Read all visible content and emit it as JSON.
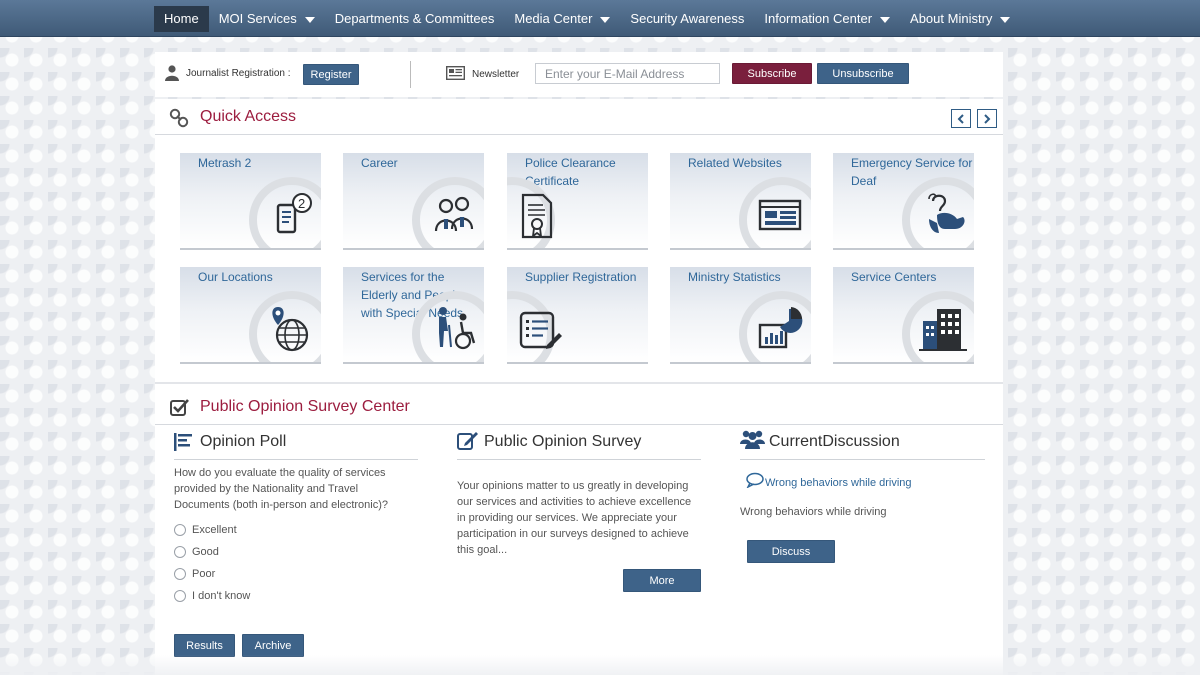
{
  "nav": {
    "items": [
      {
        "label": "Home",
        "active": true,
        "dropdown": false
      },
      {
        "label": "MOI Services",
        "dropdown": true
      },
      {
        "label": "Departments & Committees",
        "dropdown": false
      },
      {
        "label": "Media Center",
        "dropdown": true
      },
      {
        "label": "Security Awareness",
        "dropdown": false
      },
      {
        "label": "Information Center",
        "dropdown": true
      },
      {
        "label": "About Ministry",
        "dropdown": true
      }
    ]
  },
  "registration": {
    "label": "Journalist Registration :",
    "register_button": "Register"
  },
  "newsletter": {
    "label": "Newsletter",
    "email_placeholder": "Enter your E-Mail Address",
    "subscribe_button": "Subscribe",
    "unsubscribe_button": "Unsubscribe"
  },
  "quick_access": {
    "title": "Quick Access",
    "tiles": [
      {
        "label": "Metrash 2",
        "icon": "phone-metrash-icon"
      },
      {
        "label": "Career",
        "icon": "people-career-icon"
      },
      {
        "label": "Police Clearance Certificate",
        "icon": "certificate-icon"
      },
      {
        "label": "Related Websites",
        "icon": "websites-icon"
      },
      {
        "label": "Emergency Service for Deaf",
        "icon": "sign-language-icon"
      },
      {
        "label": "Our Locations",
        "icon": "globe-location-icon"
      },
      {
        "label": "Services for the Elderly and People with Special Needs",
        "icon": "elderly-wheelchair-icon"
      },
      {
        "label": "Supplier Registration",
        "icon": "supplier-form-icon"
      },
      {
        "label": "Ministry Statistics",
        "icon": "statistics-icon"
      },
      {
        "label": "Service Centers",
        "icon": "building-icon"
      }
    ]
  },
  "survey_center": {
    "title": "Public Opinion Survey Center",
    "opinion_poll": {
      "title": "Opinion Poll",
      "question": "How do you evaluate the quality of services provided by the Nationality and Travel Documents (both in-person and electronic)?",
      "options": [
        "Excellent",
        "Good",
        "Poor",
        "I don't know"
      ],
      "results_button": "Results",
      "archive_button": "Archive"
    },
    "public_survey": {
      "title": "Public Opinion Survey",
      "text": "Your opinions matter to us greatly in developing our services and activities to achieve excellence in providing our services. We appreciate your participation in our surveys designed to achieve this goal...",
      "more_button": "More"
    },
    "discussion": {
      "title": "CurrentDiscussion",
      "link": "Wrong behaviors while driving",
      "text": "Wrong behaviors while driving",
      "discuss_button": "Discuss"
    }
  },
  "colors": {
    "nav_bg": "#4a6684",
    "accent_red": "#9c1d3f",
    "button_blue": "#3e6389",
    "subscribe_maroon": "#7a1f3d",
    "link_blue": "#2f6799"
  }
}
